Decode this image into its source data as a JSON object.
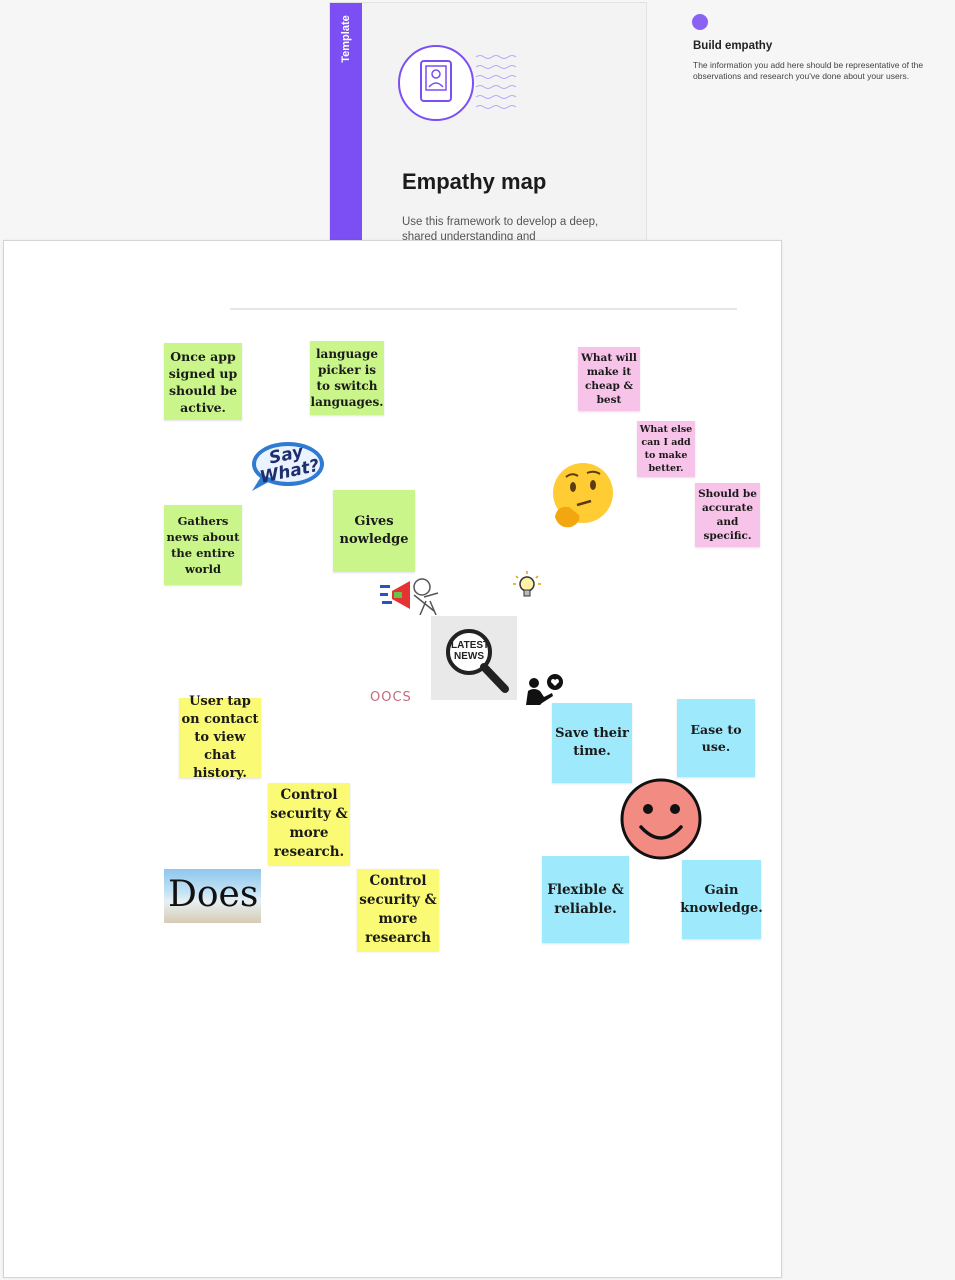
{
  "template_card": {
    "tag": "Template",
    "title": "Empathy map",
    "description": "Use this framework to develop a deep, shared understanding and"
  },
  "panel": {
    "title": "Build empathy",
    "text": "The information you add here should be representative of the observations and research you've done about your users."
  },
  "notes": {
    "green_1": "Once app signed up should be active.",
    "green_2": "language picker is to switch languages.",
    "green_3": "Gathers news about the entire world",
    "green_4": "Gives nowledge",
    "pink_1": "What will make it cheap & best",
    "pink_2": "What else can I add to make better.",
    "pink_3": "Should be accurate and specific.",
    "yellow_1": "User tap on contact to view chat history.",
    "yellow_2": "Control security & more research.",
    "yellow_3": "Control security & more research",
    "blue_1": "Save their time.",
    "blue_2": "Ease to use.",
    "blue_3": "Flexible & reliable.",
    "blue_4": "Gain knowledge."
  },
  "stickers": {
    "say_what": "Say What?",
    "latest_news": "LATEST NEWS",
    "does": "Does",
    "oocs": "OOCS"
  },
  "colors": {
    "accent": "#7b4ff3",
    "green_note": "#c9f58a",
    "pink_note": "#f7c3e9",
    "yellow_note": "#fbfa74",
    "blue_note": "#9ee9fb"
  }
}
